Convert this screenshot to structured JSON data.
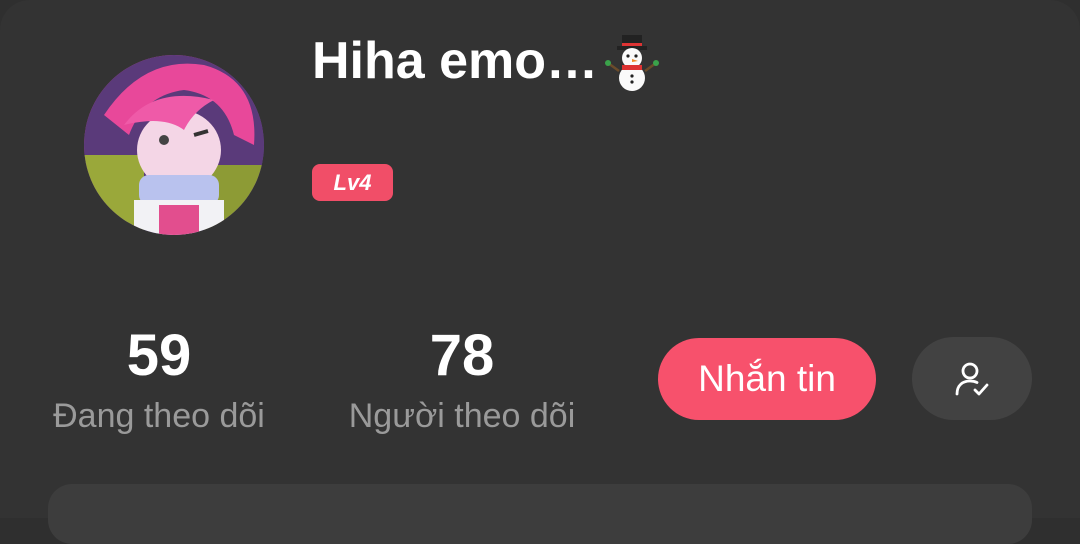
{
  "profile": {
    "username": "Hiha emo…",
    "level_badge": "Lv4"
  },
  "stats": {
    "following": {
      "value": "59",
      "label": "Đang theo dõi"
    },
    "followers": {
      "value": "78",
      "label": "Người theo dõi"
    }
  },
  "actions": {
    "message_label": "Nhắn tin"
  },
  "icons": {
    "status_emoji": "snowman-icon",
    "follow_status": "user-check-icon"
  },
  "colors": {
    "background": "#333333",
    "accent": "#f7516c",
    "badge": "#f14e68",
    "secondary_text": "#9a9a9a"
  }
}
